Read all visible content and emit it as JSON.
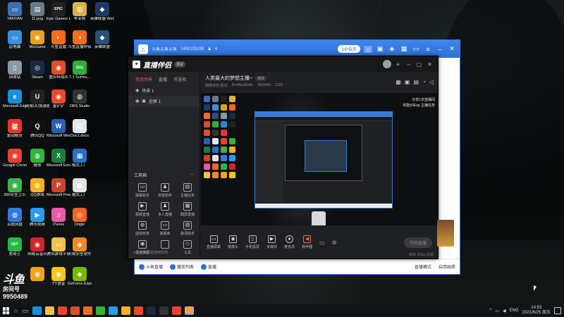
{
  "desktop": {
    "icons": [
      {
        "label": "YANYAN",
        "glyph": "▭",
        "color": "#3a6fb4"
      },
      {
        "label": "11.png",
        "glyph": "▤",
        "color": "#6b7a85"
      },
      {
        "label": "Epic Games Launcher",
        "glyph": "EPIC",
        "color": "#222"
      },
      {
        "label": "毕业照",
        "glyph": "▥",
        "color": "#d8b34a"
      },
      {
        "label": "英雄联盟 WeGame版",
        "glyph": "◆",
        "color": "#1c3a66"
      },
      {
        "label": "此电脑",
        "glyph": "▭",
        "color": "#3a8fe0"
      },
      {
        "label": "WeGame",
        "glyph": "◉",
        "color": "#e6a11e"
      },
      {
        "label": "斗鱼直播",
        "glyph": "◐",
        "color": "#f36b1c"
      },
      {
        "label": "斗鱼直播伴侣",
        "glyph": "◑",
        "color": "#f36b1c"
      },
      {
        "label": "英雄联盟",
        "glyph": "◆",
        "color": "#2a4f7a"
      },
      {
        "label": "回收站",
        "glyph": "▯",
        "color": "#889aa6"
      },
      {
        "label": "Steam",
        "glyph": "◎",
        "color": "#1b2a3e"
      },
      {
        "label": "重庆特战队",
        "glyph": "◉",
        "color": "#e04b2a"
      },
      {
        "label": "7.1 Surrou...",
        "glyph": "((o))",
        "color": "#2eae3a"
      },
      {
        "label": "Microsoft Edge",
        "glyph": "e",
        "color": "#1a8fd8"
      },
      {
        "label": "网易UU加速器",
        "glyph": "U",
        "color": "#222"
      },
      {
        "label": "金铲铲",
        "glyph": "◉",
        "color": "#e84b2a"
      },
      {
        "label": "OBS Studio",
        "glyph": "◍",
        "color": "#333"
      },
      {
        "label": "驱动精灵",
        "glyph": "驱",
        "color": "#e8352a"
      },
      {
        "label": "腾讯QQ",
        "glyph": "Q",
        "color": "#111"
      },
      {
        "label": "Microsoft Word 2010",
        "glyph": "W",
        "color": "#2b5fb3"
      },
      {
        "label": "Doc1.docx",
        "glyph": "▤",
        "color": "#dfe6ee"
      },
      {
        "label": "Google Chrome",
        "glyph": "◉",
        "color": "#e8412e"
      },
      {
        "label": "微信",
        "glyph": "◍",
        "color": "#31b539"
      },
      {
        "label": "Microsoft Excel 2010",
        "glyph": "X",
        "color": "#1e7b3c"
      },
      {
        "label": "格式工厂",
        "glyph": "▦",
        "color": "#2a6fc9"
      },
      {
        "label": "360安全卫士",
        "glyph": "◉",
        "color": "#3cb44a"
      },
      {
        "label": "QQ游戏",
        "glyph": "◍",
        "color": "#f2b31c"
      },
      {
        "label": "Microsoft PowerPoi...",
        "glyph": "P",
        "color": "#c9442a"
      },
      {
        "label": "格式工厂",
        "glyph": "▦",
        "color": "#e2e2e2"
      },
      {
        "label": "百度网盘",
        "glyph": "◍",
        "color": "#2f7be5"
      },
      {
        "label": "腾讯视频",
        "glyph": "▶",
        "color": "#2a9de8"
      },
      {
        "label": "iTunes",
        "glyph": "♫",
        "color": "#e95aa8"
      },
      {
        "label": "Origin",
        "glyph": "◎",
        "color": "#f26522"
      },
      {
        "label": "爱奇艺",
        "glyph": "iQIY",
        "color": "#24b845"
      },
      {
        "label": "网易云音乐",
        "glyph": "◉",
        "color": "#d8222a"
      },
      {
        "label": "腾讯游戏平台",
        "glyph": "▭",
        "color": "#f0c24a"
      },
      {
        "label": "火绒安全软件",
        "glyph": "◆",
        "color": "#f08a24"
      },
      {
        "label": "",
        "glyph": "◉",
        "color": "#f2a31c"
      },
      {
        "label": "YY语音",
        "glyph": "◉",
        "color": "#f5c518"
      },
      {
        "label": "GeForce Experience",
        "glyph": "◆",
        "color": "#76b900"
      }
    ]
  },
  "streamer_badge": {
    "logo": "斗鱼",
    "sub": "房间号",
    "room": "9950489"
  },
  "back_window": {
    "title": "斗鱼斗鱼斗鱼",
    "id_text": "1450105198",
    "count": "4",
    "pill": "VIP会员",
    "bottom": [
      "斗鱼直播",
      "播放列表",
      "直播"
    ],
    "bottom_right": [
      "直播模式",
      "启用画质"
    ]
  },
  "main_window": {
    "brand": "直播伴侣",
    "version": "测试",
    "tabs": [
      "常用场景",
      "直播",
      "可选项"
    ],
    "scene_group": "场景 1",
    "scene": "全屏 1",
    "tools_label": "工具箱",
    "tools": [
      "弹幕助手",
      "房管助手",
      "主播任务",
      "视频直播",
      "多人直播",
      "截屏录播",
      "虚拟形象",
      "弹幕库",
      "歌词助手",
      "语音弹幕",
      "",
      "工具"
    ],
    "footer": "斗鱼直播伴侣使用规则",
    "live_title": "人类最大的梦想主播~",
    "live_tag": "修改",
    "meta": [
      "网络状态·稳定",
      "BooBooBoBo",
      "9950489",
      "1223"
    ],
    "mission": [
      "分享1次直播间",
      "奖励50Exp 主播任务"
    ],
    "controls": [
      "直播屏幕",
      "摄像头",
      "手机投屏",
      "多媒体",
      "麦克风",
      "扬声器"
    ],
    "start_label": "开始直播",
    "status": "帧率 30fps  码率"
  },
  "taskbar": {
    "lang": "ENG",
    "time": "14:53",
    "date": "2021/6/25 周五"
  },
  "colors": {
    "accent": "#3f86ec",
    "brand_red": "#f05a5a"
  }
}
